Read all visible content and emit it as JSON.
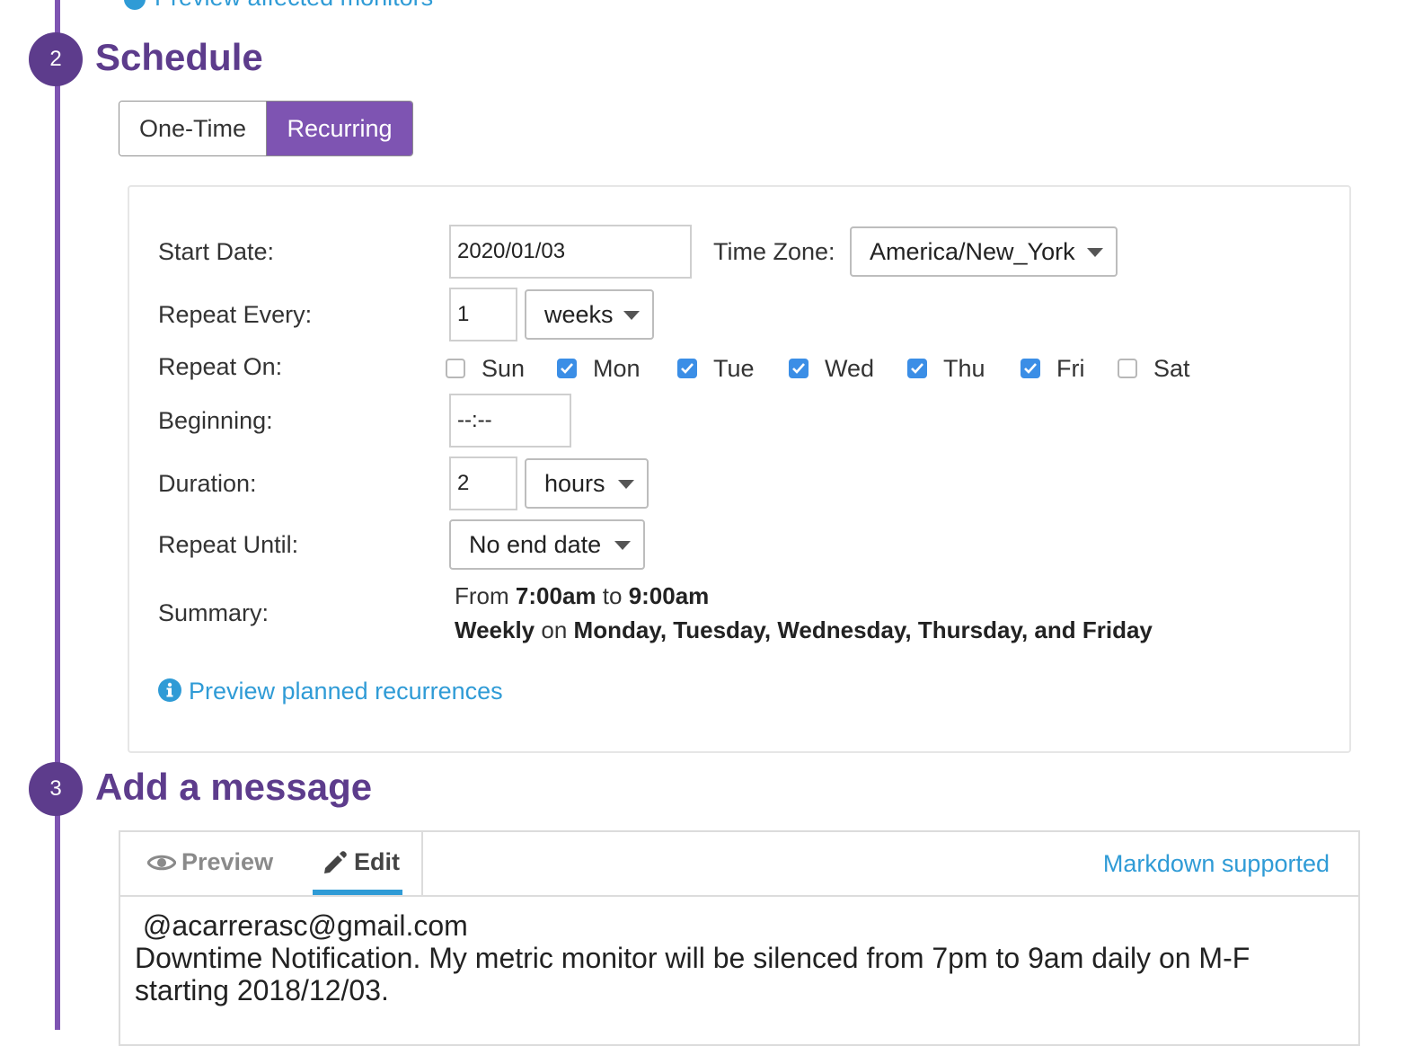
{
  "top": {
    "preview_affected_label": "Preview affected monitors"
  },
  "steps": {
    "schedule": {
      "number": "2",
      "title": "Schedule"
    },
    "message": {
      "number": "3",
      "title": "Add a message"
    }
  },
  "schedule_type": {
    "options": [
      "One-Time",
      "Recurring"
    ],
    "selected": "Recurring"
  },
  "form": {
    "start_date": {
      "label": "Start Date:",
      "value": "2020/01/03"
    },
    "time_zone": {
      "label": "Time Zone:",
      "value": "America/New_York"
    },
    "repeat_every": {
      "label": "Repeat Every:",
      "value": "1",
      "unit": "weeks"
    },
    "repeat_on": {
      "label": "Repeat On:",
      "days": [
        {
          "label": "Sun",
          "checked": false
        },
        {
          "label": "Mon",
          "checked": true
        },
        {
          "label": "Tue",
          "checked": true
        },
        {
          "label": "Wed",
          "checked": true
        },
        {
          "label": "Thu",
          "checked": true
        },
        {
          "label": "Fri",
          "checked": true
        },
        {
          "label": "Sat",
          "checked": false
        }
      ]
    },
    "beginning": {
      "label": "Beginning:",
      "value": "--:--"
    },
    "duration": {
      "label": "Duration:",
      "value": "2",
      "unit": "hours"
    },
    "repeat_until": {
      "label": "Repeat Until:",
      "value": "No end date"
    },
    "summary": {
      "label": "Summary:",
      "from_word": "From",
      "from_time": "7:00am",
      "to_word": "to",
      "to_time": "9:00am",
      "frequency": "Weekly",
      "on_word": "on",
      "days_text": "Monday, Tuesday, Wednesday, Thursday, and Friday"
    },
    "preview_link": "Preview planned recurrences"
  },
  "message": {
    "tabs": {
      "preview": "Preview",
      "edit": "Edit",
      "active": "Edit"
    },
    "markdown_link": "Markdown supported",
    "lines": [
      " @acarrerasc@gmail.com",
      "Downtime Notification. My metric monitor will be silenced from 7pm to 9am daily on M-F",
      "starting 2018/12/03."
    ]
  },
  "colors": {
    "accent_purple": "#7e54b2",
    "step_purple": "#5d3c8c",
    "link_blue": "#2f9bd6",
    "checkbox_blue": "#3b8ee6"
  }
}
